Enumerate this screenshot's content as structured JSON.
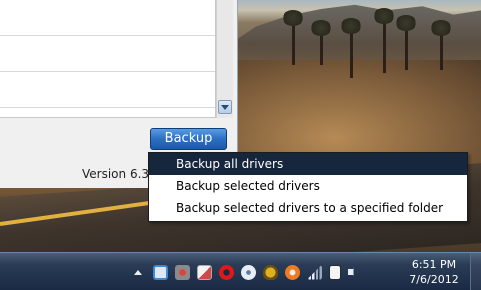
{
  "window": {
    "backup_button": "Backup",
    "version_label": "Version 6.3"
  },
  "context_menu": {
    "items": [
      {
        "label": "Backup all drivers",
        "highlighted": true
      },
      {
        "label": "Backup selected drivers",
        "highlighted": false
      },
      {
        "label": "Backup selected drivers to a specified folder",
        "highlighted": false
      }
    ]
  },
  "taskbar": {
    "clock_time": "6:51 PM",
    "clock_date": "7/6/2012",
    "tray_icons": [
      "show-hidden-icons-arrow",
      "app-s-icon",
      "tool-icon",
      "mail-icon",
      "opera-icon",
      "disc-icon",
      "bug-icon",
      "firefox-icon",
      "network-signal-icon",
      "clipboard-icon",
      "volume-icon"
    ]
  },
  "colors": {
    "menu_highlight": "#16273d",
    "backup_button": "#2c6fc2",
    "taskbar": "#1a2a44"
  }
}
